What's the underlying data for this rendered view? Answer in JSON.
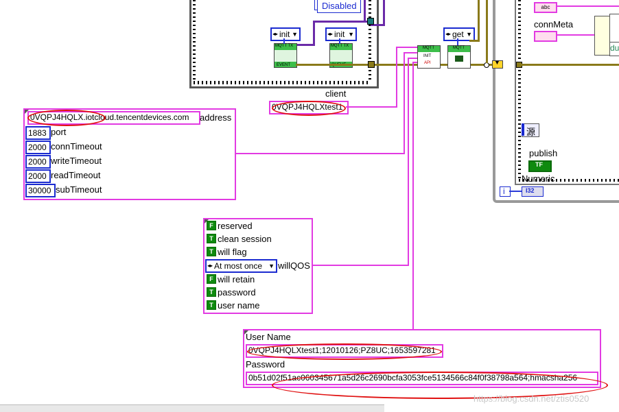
{
  "top_diagram": {
    "disabled_label": "Disabled",
    "init_label_1": "init",
    "init_label_2": "init",
    "get_label": "get",
    "mqtt_tx_1": "MQTT TX",
    "mqtt_tx_1_sub": "EVENT",
    "mqtt_tx_2": "MQTT TX",
    "mqtt_tx_2_sub": "QUEUE",
    "mqtt_init_top": "MQTT",
    "mqtt_init_mid": "INIT",
    "mqtt_init_bot": "API",
    "mqtt_get_top": "MQTT",
    "client_label": "client",
    "client_value": "0VQPJ4HQLXtest1"
  },
  "right_panel": {
    "abc_icon": "abc",
    "connmeta_label": "connMeta",
    "du_label": "du",
    "source_label": "源",
    "publish_label": "publish",
    "publish_const": "TF",
    "numeric_label": "Numeric",
    "index_label": "i",
    "i32_label": "I32"
  },
  "address_cluster": {
    "address_value": "0VQPJ4HQLX.iotcloud.tencentdevices.com",
    "address_label": "address",
    "rows": [
      {
        "value": "1883",
        "label": "port"
      },
      {
        "value": "2000",
        "label": "connTimeout"
      },
      {
        "value": "2000",
        "label": "writeTimeout"
      },
      {
        "value": "2000",
        "label": "readTimeout"
      },
      {
        "value": "30000",
        "label": "subTimeout"
      }
    ]
  },
  "flags_cluster": {
    "reserved": {
      "state": "F",
      "label": "reserved"
    },
    "clean_session": {
      "state": "T",
      "label": "clean session"
    },
    "will_flag": {
      "state": "T",
      "label": "will flag"
    },
    "will_qos": {
      "value": "At most once",
      "label": "willQOS"
    },
    "will_retain": {
      "state": "F",
      "label": "will retain"
    },
    "password": {
      "state": "T",
      "label": "password"
    },
    "user_name": {
      "state": "T",
      "label": "user name"
    }
  },
  "credentials": {
    "username_label": "User Name",
    "username_value": "0VQPJ4HQLXtest1;12010126;PZ8UC;1653597281",
    "password_label": "Password",
    "password_value": "0b51d02f51ac060345671a5d26c2690bcfa3053fce5134566c84f0f38798a564;hmacsha256"
  },
  "watermark": "https://blog.csdn.net/ztis0520",
  "colors": {
    "string_wire": "#e23ae2",
    "numeric_blue": "#1a2ad0",
    "bool_green": "#0f8a0f",
    "mqtt_green": "#3dbe4a"
  }
}
